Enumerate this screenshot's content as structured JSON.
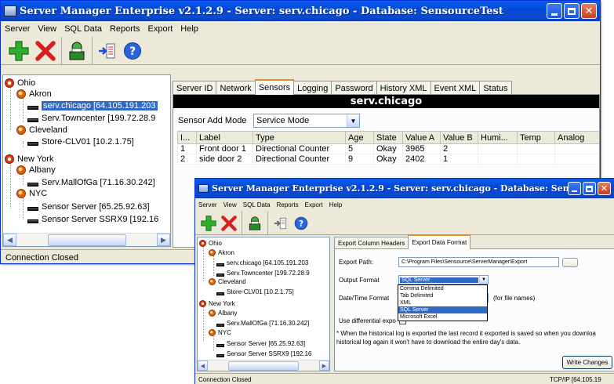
{
  "win1": {
    "title": "Server Manager Enterprise v2.1.2.9  -  Server: serv.chicago  - Database: SensourceTest",
    "menu": [
      "Server",
      "View",
      "SQL Data",
      "Reports",
      "Export",
      "Help"
    ],
    "toolbar_icons": [
      "add-icon",
      "delete-icon",
      "user-icon",
      "export-icon",
      "help-icon"
    ],
    "tree": {
      "ohio": "Ohio",
      "akron": "Akron",
      "serv_chicago": "serv.chicago  [64.105.191.203",
      "serv_towncenter": "Serv.Towncenter  [199.72.28.9",
      "cleveland": "Cleveland",
      "store_clv01": "Store-CLV01  [10.2.1.75]",
      "new_york": "New York",
      "albany": "Albany",
      "serv_mallofga": "Serv.MallOfGa  [71.16.30.242]",
      "nyc": "NYC",
      "sensor_server": "Sensor Server  [65.25.92.63]",
      "sensor_server_ssrx9": "Sensor Server SSRX9  [192.16"
    },
    "tabs": [
      "Server ID",
      "Network",
      "Sensors",
      "Logging",
      "Password",
      "History XML",
      "Event XML",
      "Status"
    ],
    "active_tab": "Sensors",
    "banner": "serv.chicago",
    "sensor_add_mode_label": "Sensor Add Mode",
    "sensor_add_mode_value": "Service Mode",
    "columns": [
      "I...",
      "Label",
      "Type",
      "Age",
      "State",
      "Value A",
      "Value B",
      "Humi...",
      "Temp",
      "Analog"
    ],
    "rows": [
      [
        "1",
        "Front door 1",
        "Directional Counter",
        "5",
        "Okay",
        "3965",
        "2",
        "",
        "",
        ""
      ],
      [
        "2",
        "side door 2",
        "Directional Counter",
        "9",
        "Okay",
        "2402",
        "1",
        "",
        "",
        ""
      ]
    ],
    "status": "Connection Closed"
  },
  "win2": {
    "title": "Server Manager Enterprise v2.1.2.9  -  Server: serv.chicago  - Database: SensourceTest",
    "menu": [
      "Server",
      "View",
      "SQL Data",
      "Reports",
      "Export",
      "Help"
    ],
    "tabs": [
      "Export Column Headers",
      "Export Data Format"
    ],
    "active_tab": "Export Data Format",
    "export_path_label": "Export Path:",
    "export_path_value": "C:\\Program Files\\Sensource\\ServerManager\\Export",
    "output_format_label": "Output Format",
    "output_format_value": "SQL Server",
    "format_options": [
      "Comma Delimited",
      "Tab Delimited",
      "XML",
      "SQL Server",
      "Microsoft Excel"
    ],
    "selected_format": "SQL Server",
    "datetime_format_label": "Date/Time Format",
    "for_file_names": "(for file names)",
    "differential_label": "Use differential expo",
    "note": "* When the historical log is exported the last record it exported is saved so when you downloa historical log again it won't have to download the entire day's data.",
    "write_changes": "Write Changes",
    "status_left": "Connection Closed",
    "status_right": "TCP/IP  [64.105.19"
  },
  "colors": {
    "titlebar": "#0a4ad0",
    "selection": "#316ac5",
    "active_tab_accent": "#e68b2c",
    "window_bg": "#ece9d8"
  }
}
